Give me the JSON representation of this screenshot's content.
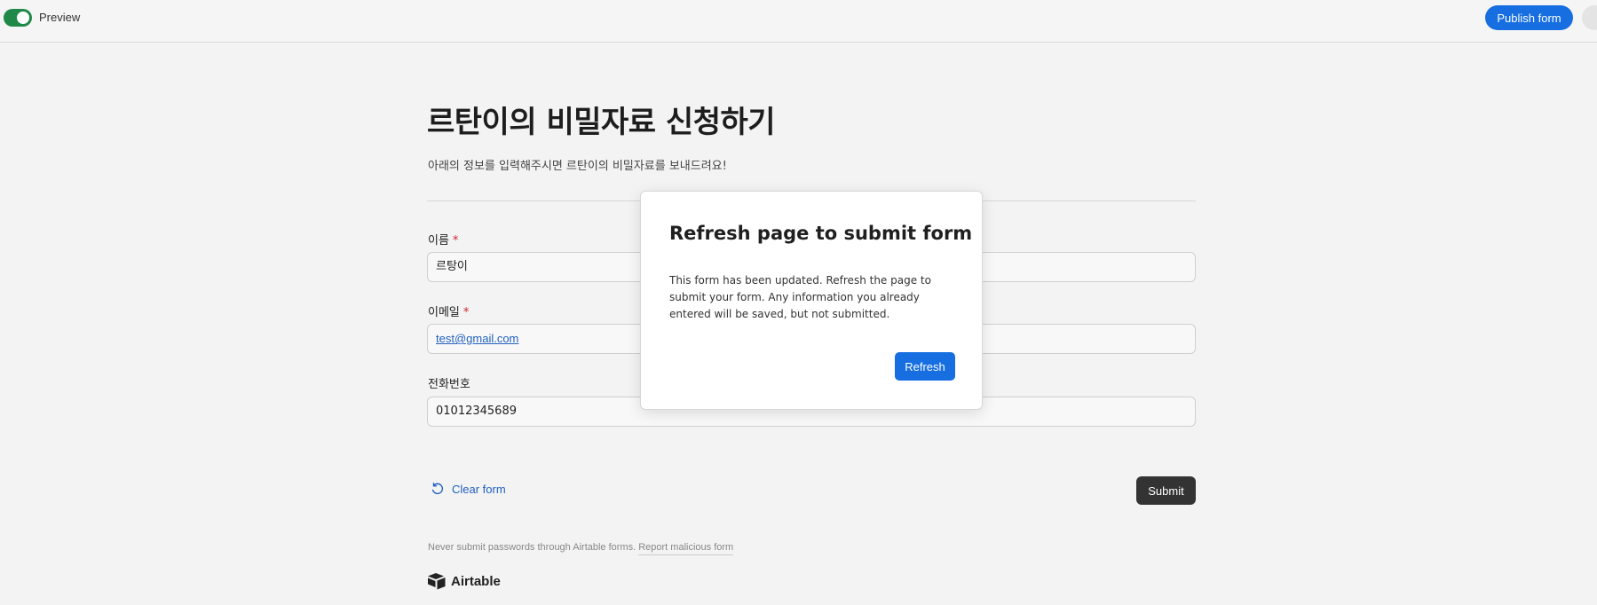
{
  "topbar": {
    "preview_label": "Preview",
    "publish_label": "Publish form"
  },
  "form": {
    "title": "르탄이의 비밀자료 신청하기",
    "description": "아래의 정보를 입력해주시면 르탄이의 비밀자료를 보내드려요!",
    "fields": [
      {
        "label": "이름",
        "required": "*",
        "value": "르탕이"
      },
      {
        "label": "이메일",
        "required": "*",
        "value": "test@gmail.com"
      },
      {
        "label": "전화번호",
        "required": "",
        "value": "01012345689"
      }
    ],
    "clear_label": "Clear form",
    "submit_label": "Submit"
  },
  "footer": {
    "note": "Never submit passwords through Airtable forms.",
    "report_link": "Report malicious form",
    "brand": "Airtable"
  },
  "modal": {
    "title": "Refresh page to submit form",
    "body": "This form has been updated. Refresh the page to submit your form. Any information you already entered will be saved, but not submitted.",
    "button_label": "Refresh"
  },
  "colors": {
    "accent": "#166ee1",
    "toggle_on": "#20894a",
    "submit": "#333333",
    "required": "#d0262f"
  }
}
